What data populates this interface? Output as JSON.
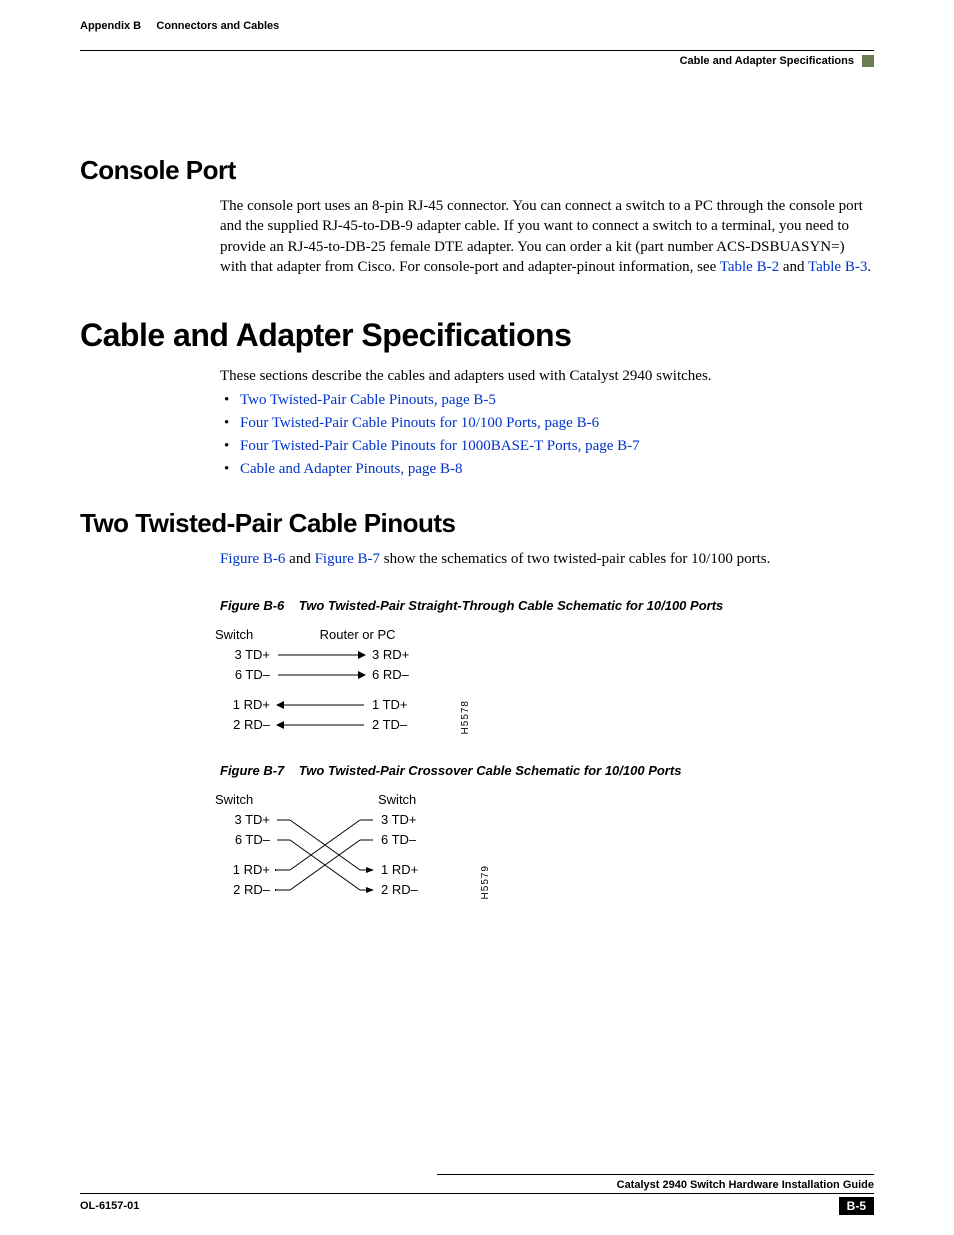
{
  "header": {
    "left_prefix": "Appendix B",
    "left_title": "Connectors and Cables",
    "right": "Cable and Adapter Specifications"
  },
  "sections": {
    "console_port": {
      "heading": "Console Port",
      "para": "The console port uses an 8-pin RJ-45 connector. You can connect a switch to a PC through the console port and the supplied RJ-45-to-DB-9 adapter cable. If you want to connect a switch to a terminal, you need to provide an RJ-45-to-DB-25 female DTE adapter. You can order a kit (part number ACS-DSBUASYN=) with that adapter from Cisco. For console-port and adapter-pinout information, see ",
      "link1": "Table B-2",
      "mid": " and ",
      "link2": "Table B-3",
      "end": "."
    },
    "cable_spec": {
      "heading": "Cable and Adapter Specifications",
      "intro": "These sections describe the cables and adapters used with Catalyst 2940 switches.",
      "bullets": [
        "Two Twisted-Pair Cable Pinouts, page B-5",
        "Four Twisted-Pair Cable Pinouts for 10/100 Ports, page B-6",
        "Four Twisted-Pair Cable Pinouts for 1000BASE-T Ports, page B-7",
        "Cable and Adapter Pinouts, page B-8"
      ]
    },
    "two_twisted": {
      "heading": "Two Twisted-Pair Cable Pinouts",
      "para_pre": "",
      "link1": "Figure B-6",
      "mid": " and ",
      "link2": "Figure B-7",
      "para_post": " show the schematics of two twisted-pair cables for 10/100 ports."
    }
  },
  "figures": {
    "b6": {
      "caption_prefix": "Figure B-6",
      "caption_text": "Two Twisted-Pair Straight-Through Cable Schematic for 10/100 Ports",
      "left_header": "Switch",
      "right_header": "Router or PC",
      "rows": [
        {
          "l": "3 TD+",
          "r": "3 RD+",
          "dir": "right"
        },
        {
          "l": "6 TD–",
          "r": "6 RD–",
          "dir": "right"
        },
        {
          "l": "1 RD+",
          "r": "1 TD+",
          "dir": "left"
        },
        {
          "l": "2 RD–",
          "r": "2 TD–",
          "dir": "left"
        }
      ],
      "side": "H5578"
    },
    "b7": {
      "caption_prefix": "Figure B-7",
      "caption_text": "Two Twisted-Pair Crossover Cable Schematic for 10/100 Ports",
      "left_header": "Switch",
      "right_header": "Switch",
      "left_pins": [
        "3 TD+",
        "6 TD–",
        "1 RD+",
        "2 RD–"
      ],
      "right_pins": [
        "3 TD+",
        "6 TD–",
        "1 RD+",
        "2 RD–"
      ],
      "side": "H5579"
    }
  },
  "footer": {
    "title": "Catalyst 2940 Switch Hardware Installation Guide",
    "doc": "OL-6157-01",
    "page": "B-5"
  }
}
